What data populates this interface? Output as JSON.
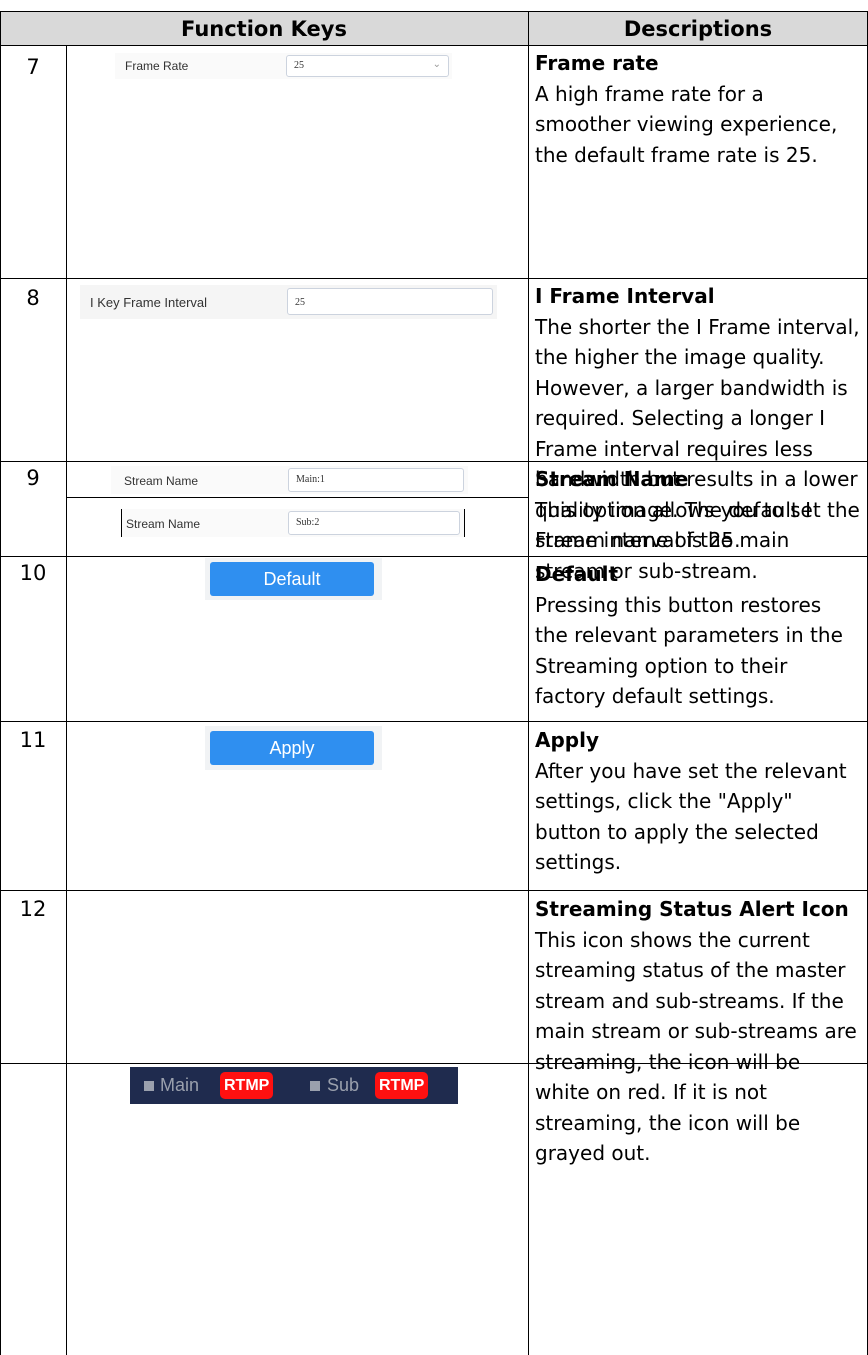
{
  "headers": {
    "function_keys": "Function Keys",
    "descriptions": "Descriptions"
  },
  "rows": [
    {
      "num": "7",
      "title": "Frame rate",
      "body": "A high frame rate for a smoother viewing experience, the default frame rate is 25.",
      "ui": {
        "label": "Frame Rate",
        "value": "25"
      }
    },
    {
      "num": "8",
      "title": "I Frame Interval",
      "body": "The shorter the I Frame interval, the higher the image quality. However, a larger bandwidth is required. Selecting a longer I Frame interval requires less bandwidth but results in a lower quality image. The default I Frame interval is 25.",
      "ui": {
        "label": "I Key Frame Interval",
        "value": "25"
      }
    },
    {
      "num": "9",
      "title": "Stream Name",
      "body": "This option allows you to set the stream name of the main stream or sub-stream.",
      "ui": {
        "main": {
          "label": "Stream Name",
          "value": "Main:1"
        },
        "sub": {
          "label": "Stream Name",
          "value": "Sub:2"
        }
      }
    },
    {
      "num": "10",
      "title": "Default",
      "body": "Pressing this button restores the relevant parameters in the Streaming option to their factory default settings.",
      "ui": {
        "button_label": "Default"
      }
    },
    {
      "num": "11",
      "title": "Apply",
      "body": "After you have set the relevant settings, click the \"Apply\" button to apply the selected settings.",
      "ui": {
        "button_label": "Apply"
      }
    },
    {
      "num": "12",
      "title": "Streaming Status Alert Icon",
      "body": "This icon shows the current streaming status of the master stream and sub-streams. If the main stream or sub-streams are streaming, the icon will be white on red. If it is not streaming, the icon will be grayed out.",
      "ui": {
        "main_label": "Main",
        "sub_label": "Sub",
        "badge": "RTMP"
      }
    }
  ],
  "colors": {
    "header_bg": "#d9d9d9",
    "button_blue": "#2f8ff0",
    "status_bar_bg": "#1f2b4e",
    "rtmp_red": "#ff1010"
  }
}
